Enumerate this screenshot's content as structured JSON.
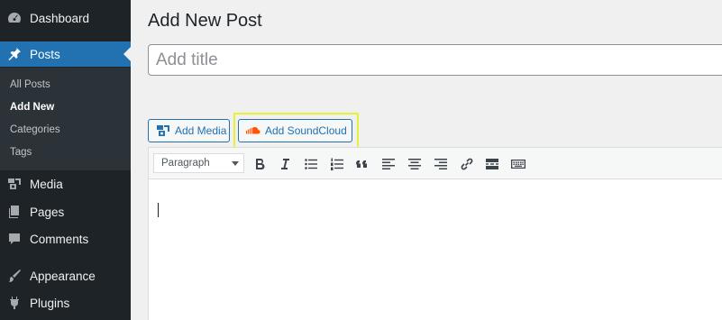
{
  "sidebar": {
    "items": [
      {
        "label": "Dashboard",
        "icon": "dashboard-icon"
      },
      {
        "label": "Posts",
        "icon": "pin-icon",
        "active": true
      },
      {
        "label": "Media",
        "icon": "media-icon"
      },
      {
        "label": "Pages",
        "icon": "pages-icon"
      },
      {
        "label": "Comments",
        "icon": "comment-icon"
      },
      {
        "label": "Appearance",
        "icon": "brush-icon"
      },
      {
        "label": "Plugins",
        "icon": "plug-icon"
      }
    ],
    "submenu": [
      {
        "label": "All Posts"
      },
      {
        "label": "Add New",
        "current": true
      },
      {
        "label": "Categories"
      },
      {
        "label": "Tags"
      }
    ]
  },
  "main": {
    "page_title": "Add New Post",
    "title_placeholder": "Add title",
    "add_media_label": "Add Media",
    "add_soundcloud_label": "Add SoundCloud"
  },
  "editor": {
    "format_value": "Paragraph",
    "toolbar_icons": [
      "bold-icon",
      "italic-icon",
      "bullet-list-icon",
      "numbered-list-icon",
      "blockquote-icon",
      "align-left-icon",
      "align-center-icon",
      "align-right-icon",
      "link-icon",
      "read-more-icon",
      "toolbar-toggle-icon"
    ]
  },
  "colors": {
    "sidebar_bg": "#1d2327",
    "active_blue": "#2271b1",
    "highlight": "#e5f235",
    "soundcloud_orange": "#ff5500"
  }
}
